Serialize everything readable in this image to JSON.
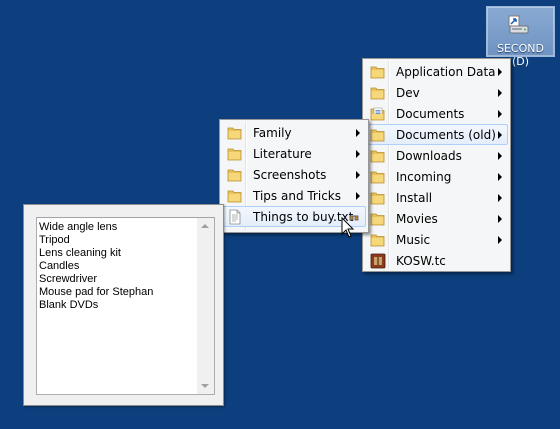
{
  "desktop": {
    "background": "#0d3f7e",
    "drive_button": {
      "label": "SECOND (D)",
      "icon": "drive-shortcut-icon"
    }
  },
  "main_menu": {
    "items": [
      {
        "label": "Application Data",
        "icon": "folder-icon",
        "submenu": true
      },
      {
        "label": "Dev",
        "icon": "folder-icon",
        "submenu": true
      },
      {
        "label": "Documents",
        "icon": "documents-folder-icon",
        "submenu": true
      },
      {
        "label": "Documents (old)",
        "icon": "folder-icon",
        "submenu": true,
        "highlighted": true
      },
      {
        "label": "Downloads",
        "icon": "folder-icon",
        "submenu": true
      },
      {
        "label": "Incoming",
        "icon": "folder-icon",
        "submenu": true
      },
      {
        "label": "Install",
        "icon": "folder-icon",
        "submenu": true
      },
      {
        "label": "Movies",
        "icon": "folder-icon",
        "submenu": true
      },
      {
        "label": "Music",
        "icon": "folder-icon",
        "submenu": true
      },
      {
        "label": "KOSW.tc",
        "icon": "tc-file-icon",
        "submenu": false
      }
    ]
  },
  "sub_menu": {
    "items": [
      {
        "label": "Family",
        "icon": "folder-icon",
        "submenu": true
      },
      {
        "label": "Literature",
        "icon": "folder-icon",
        "submenu": true
      },
      {
        "label": "Screenshots",
        "icon": "folder-icon",
        "submenu": true
      },
      {
        "label": "Tips and Tricks",
        "icon": "folder-icon",
        "submenu": true
      },
      {
        "label": "Things to buy.txt",
        "icon": "text-file-icon",
        "submenu": false,
        "highlighted": true,
        "preview_indicator": "glasses-icon"
      }
    ]
  },
  "preview": {
    "lines": [
      "Wide angle lens",
      "Tripod",
      "Lens cleaning kit",
      "Candles",
      "Screwdriver",
      "Mouse pad for Stephan",
      "Blank DVDs"
    ]
  },
  "colors": {
    "highlight_border": "#aecff7",
    "menu_background": "#f5f6f7",
    "folder": "#e8c25a"
  }
}
